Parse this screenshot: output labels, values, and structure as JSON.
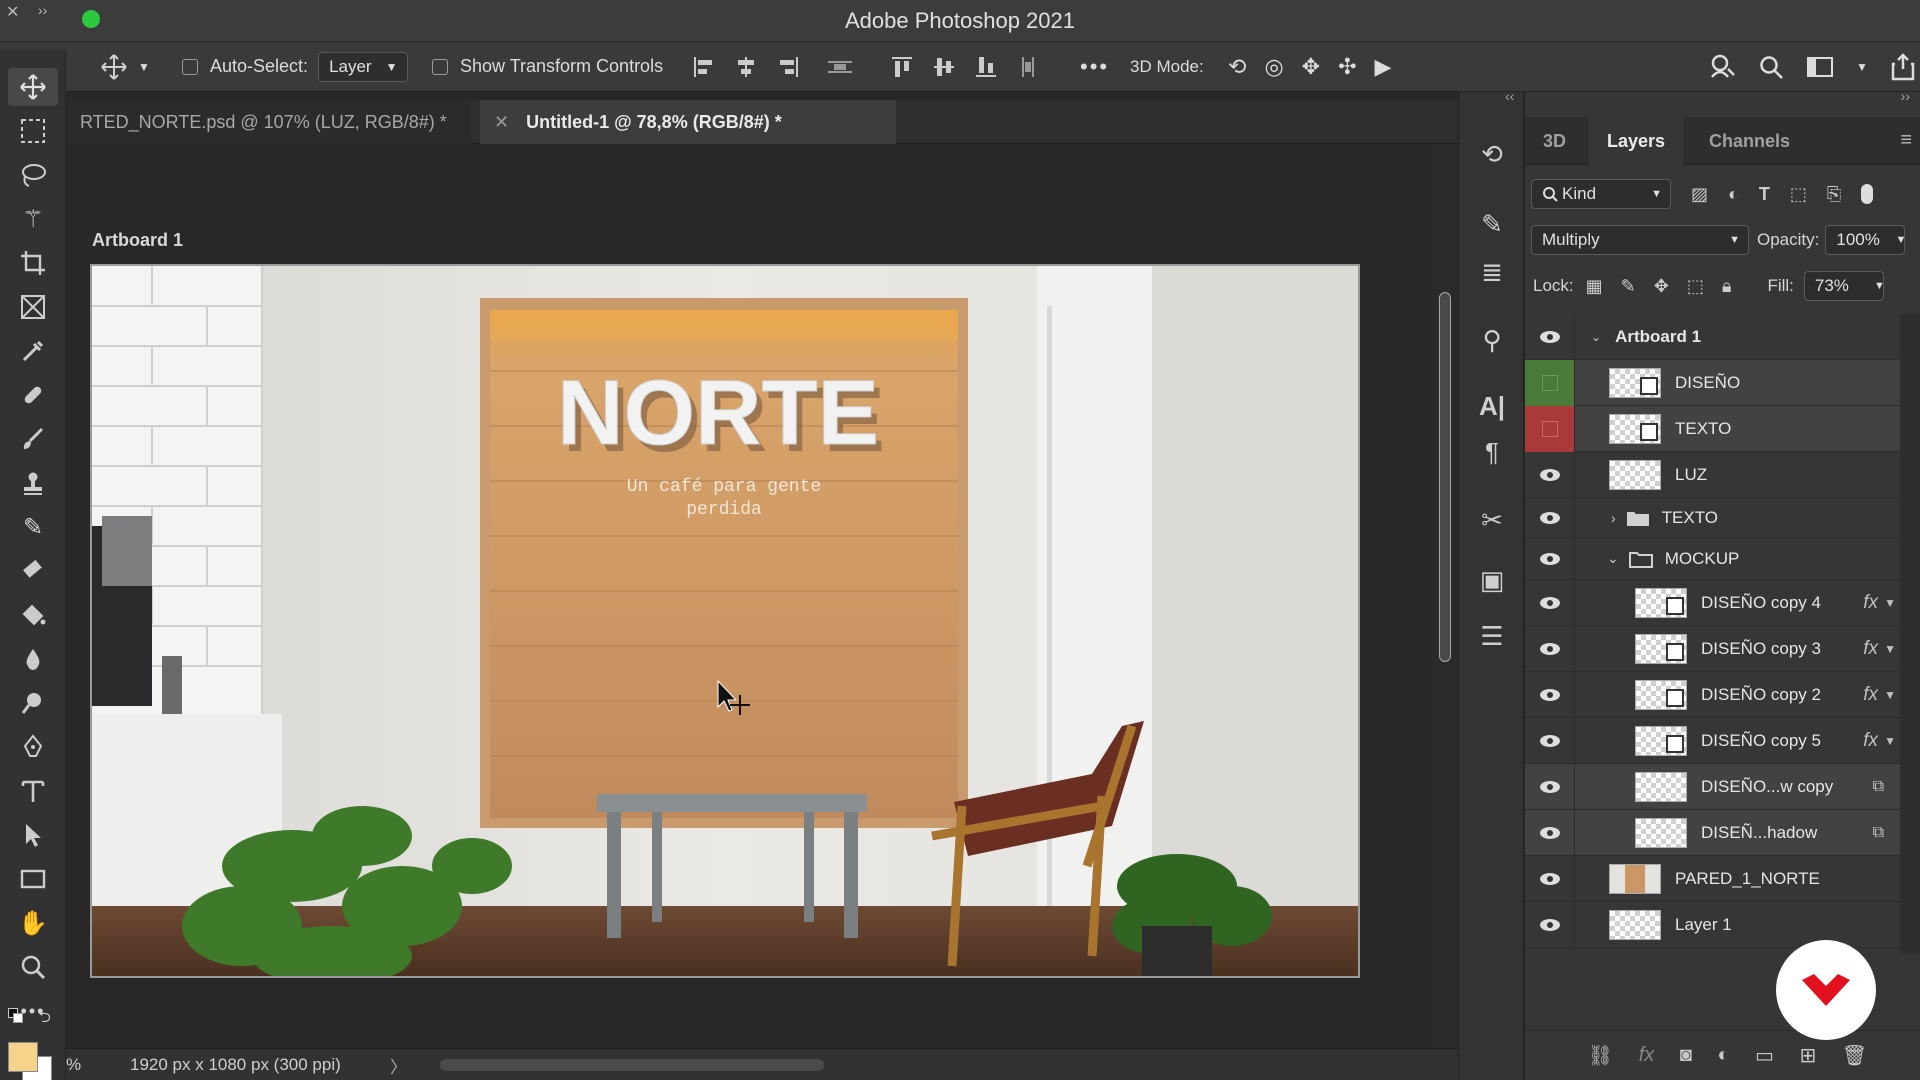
{
  "window": {
    "title": "Adobe Photoshop 2021"
  },
  "options_bar": {
    "auto_select_label": "Auto-Select:",
    "auto_select_value": "Layer",
    "show_transform_label": "Show Transform Controls",
    "mode_3d_label": "3D Mode:"
  },
  "tabs": [
    {
      "label": "RTED_NORTE.psd @ 107% (LUZ, RGB/8#) *",
      "active": false
    },
    {
      "label": "Untitled-1 @ 78,8% (RGB/8#) *",
      "active": true
    }
  ],
  "canvas": {
    "artboard_label": "Artboard 1",
    "sign_title": "NORTE",
    "sign_subtitle_1": "Un café para gente",
    "sign_subtitle_2": "perdida"
  },
  "status_bar": {
    "zoom_suffix": "%",
    "doc_info": "1920 px x 1080 px (300 ppi)"
  },
  "layers_panel": {
    "tabs": [
      "3D",
      "Layers",
      "Channels"
    ],
    "active_tab": "Layers",
    "filter_kind": "Kind",
    "blend_mode": "Multiply",
    "opacity_label": "Opacity:",
    "opacity_value": "100%",
    "lock_label": "Lock:",
    "fill_label": "Fill:",
    "fill_value": "73%",
    "layers": [
      {
        "name": "Artboard 1",
        "type": "artboard",
        "visible": true
      },
      {
        "name": "DISEÑO",
        "type": "smart",
        "visible": false,
        "tag_color": "#4a7a3a"
      },
      {
        "name": "TEXTO",
        "type": "smart",
        "visible": false,
        "tag_color": "#a83a3a"
      },
      {
        "name": "LUZ",
        "type": "pixel",
        "visible": true
      },
      {
        "name": "TEXTO",
        "type": "group",
        "visible": true,
        "expanded": false
      },
      {
        "name": "MOCKUP",
        "type": "group",
        "visible": true,
        "expanded": true
      },
      {
        "name": "DISEÑO copy 4",
        "type": "smart",
        "visible": true,
        "fx": true
      },
      {
        "name": "DISEÑO copy 3",
        "type": "smart",
        "visible": true,
        "fx": true
      },
      {
        "name": "DISEÑO copy 2",
        "type": "smart",
        "visible": true,
        "fx": true
      },
      {
        "name": "DISEÑO copy 5",
        "type": "smart",
        "visible": true,
        "fx": true
      },
      {
        "name": "DISEÑO...w copy",
        "type": "pixel",
        "visible": true,
        "linked": true
      },
      {
        "name": "DISEÑ...hadow",
        "type": "pixel",
        "visible": true,
        "linked": true
      },
      {
        "name": "PARED_1_NORTE",
        "type": "image",
        "visible": true
      },
      {
        "name": "Layer 1",
        "type": "pixel",
        "visible": true
      }
    ],
    "fx_label": "fx"
  },
  "colors": {
    "foreground": "#f5d38a",
    "background": "#ffffff",
    "accent_logo": "#e3101e"
  }
}
